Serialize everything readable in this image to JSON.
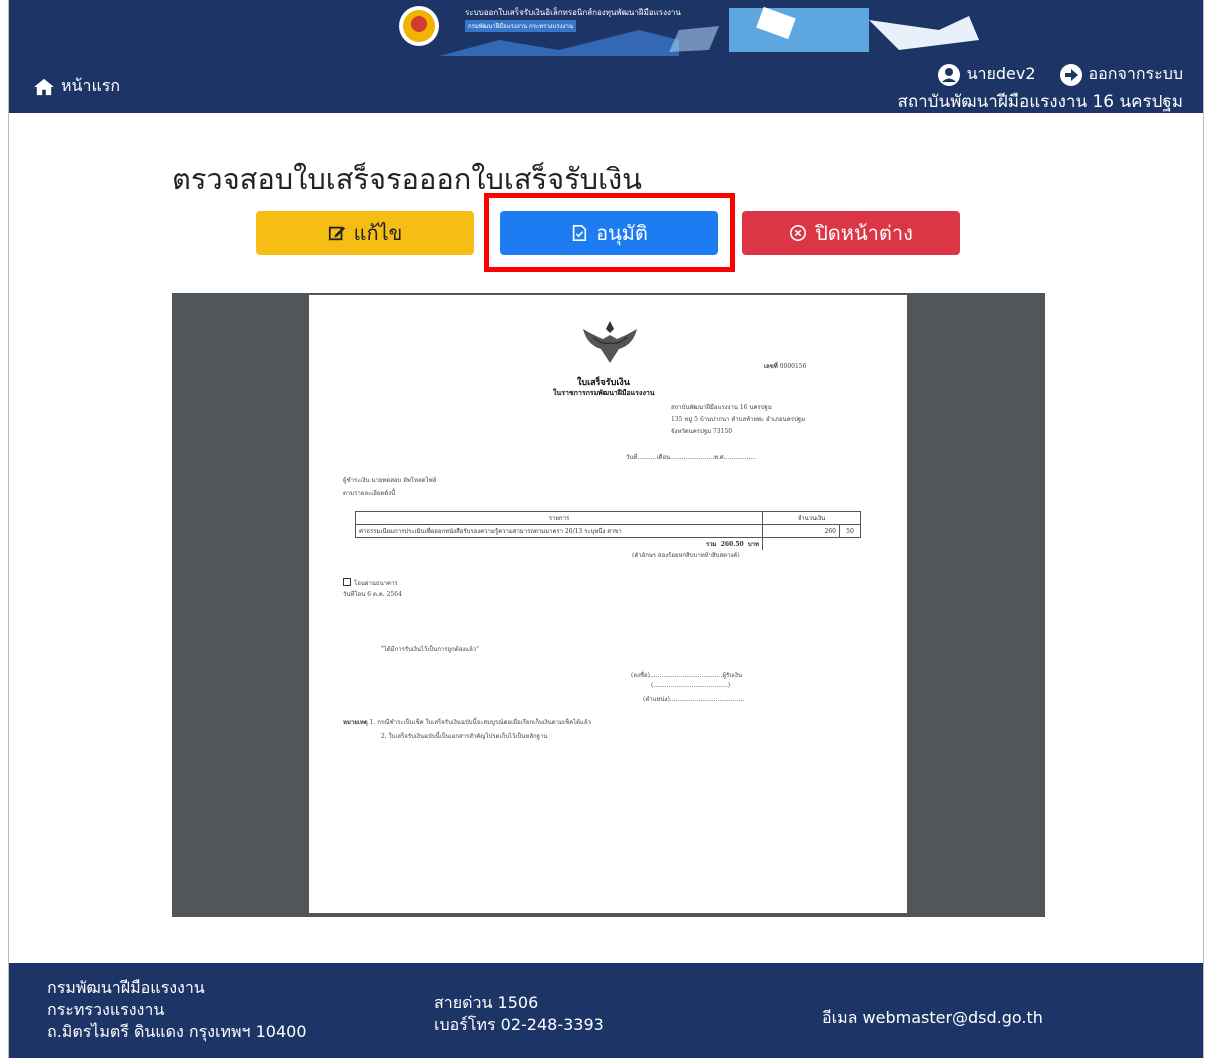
{
  "header": {
    "banner_title": "ระบบออกใบเสร็จรับเงินอิเล็กทรอนิกส์กองทุนพัฒนาฝีมือแรงงาน",
    "banner_subtitle": "กรมพัฒนาฝีมือแรงงาน กระทรวงแรงงาน",
    "home_label": "หน้าแรก",
    "user_label": "นายdev2",
    "logout_label": "ออกจากระบบ",
    "org_name": "สถาบันพัฒนาฝีมือแรงงาน 16 นครปฐม"
  },
  "page": {
    "title": "ตรวจสอบใบเสร็จรอออกใบเสร็จรับเงิน"
  },
  "toolbar": {
    "edit_label": "แก้ไข",
    "approve_label": "อนุมัติ",
    "close_label": "ปิดหน้าต่าง"
  },
  "document": {
    "number_label": "เลขที่",
    "number": "0000156",
    "title": "ใบเสร็จรับเงิน",
    "subtitle": "ในราชการกรมพัฒนาฝีมือแรงงาน",
    "issuer_line1": "สถาบันพัฒนาฝีมือแรงงาน 16 นครปฐม",
    "issuer_line2": "135 หมู่ 5 บ้านปากนา ตำบลท้ายพะ อำเภอนครปฐม",
    "issuer_line3": "จังหวัดนครปฐม 73150",
    "date_line": "วันที่..........เดือน.......................พ.ศ.................",
    "payer_line": "ผู้ชำระเงิน นายทดสอบ อัพโหลดไฟล์",
    "payer_detail": "ตามรายละเอียดดังนี้",
    "table_header_item": "รายการ",
    "table_header_amount": "จำนวนเงิน",
    "row_desc": "ค่าธรรมเนียมการประเมินเพื่อออกหนังสือรับรองความรู้ความสามารถตามมาตรา 26/13 ระบุหนึ่ง สาขา",
    "row_baht": "260",
    "row_satang": "50",
    "total_label": "รวม",
    "total_value": "260.50",
    "total_unit": "บาท",
    "total_words": "(ตัวอักษร สองร้อยหกสิบบาทห้าสิบสตางค์)",
    "pay_method": "โอนผ่านธนาคาร",
    "pay_date": "วันที่โอน 6 ต.ค. 2564",
    "received_note": "\"ได้มีการรับเงินไว้เป็นการถูกต้องแล้ว\"",
    "signature_line": "(ลงชื่อ)......................................ผู้รับเงิน",
    "name_line": "(.......................................)",
    "position_line": "(ตำแหน่ง).......................................",
    "remark_label": "หมายเหตุ",
    "remark_1": "1. กรณีชำระเป็นเช็ค ใบเสร็จรับเงินฉบับนี้จะสมบูรณ์ต่อเมื่อเรียกเก็บเงินตามเช็คได้แล้ว",
    "remark_2": "2. ใบเสร็จรับเงินฉบับนี้เป็นเอกสารสำคัญโปรดเก็บไว้เป็นหลักฐาน"
  },
  "footer": {
    "dept_line1": "กรมพัฒนาฝีมือแรงงาน",
    "dept_line2": "กระทรวงแรงงาน",
    "dept_line3": "ถ.มิตรไมตรี ดินแดง กรุงเทพฯ 10400",
    "hotline": "สายด่วน 1506",
    "phone": "เบอร์โทร 02-248-3393",
    "email": "อีเมล webmaster@dsd.go.th"
  },
  "colors": {
    "header_bg": "#1d3566",
    "edit": "#f6be14",
    "approve": "#1e7cf2",
    "close": "#dc3545",
    "highlight": "#ff0000",
    "viewer_bg": "#525659"
  }
}
